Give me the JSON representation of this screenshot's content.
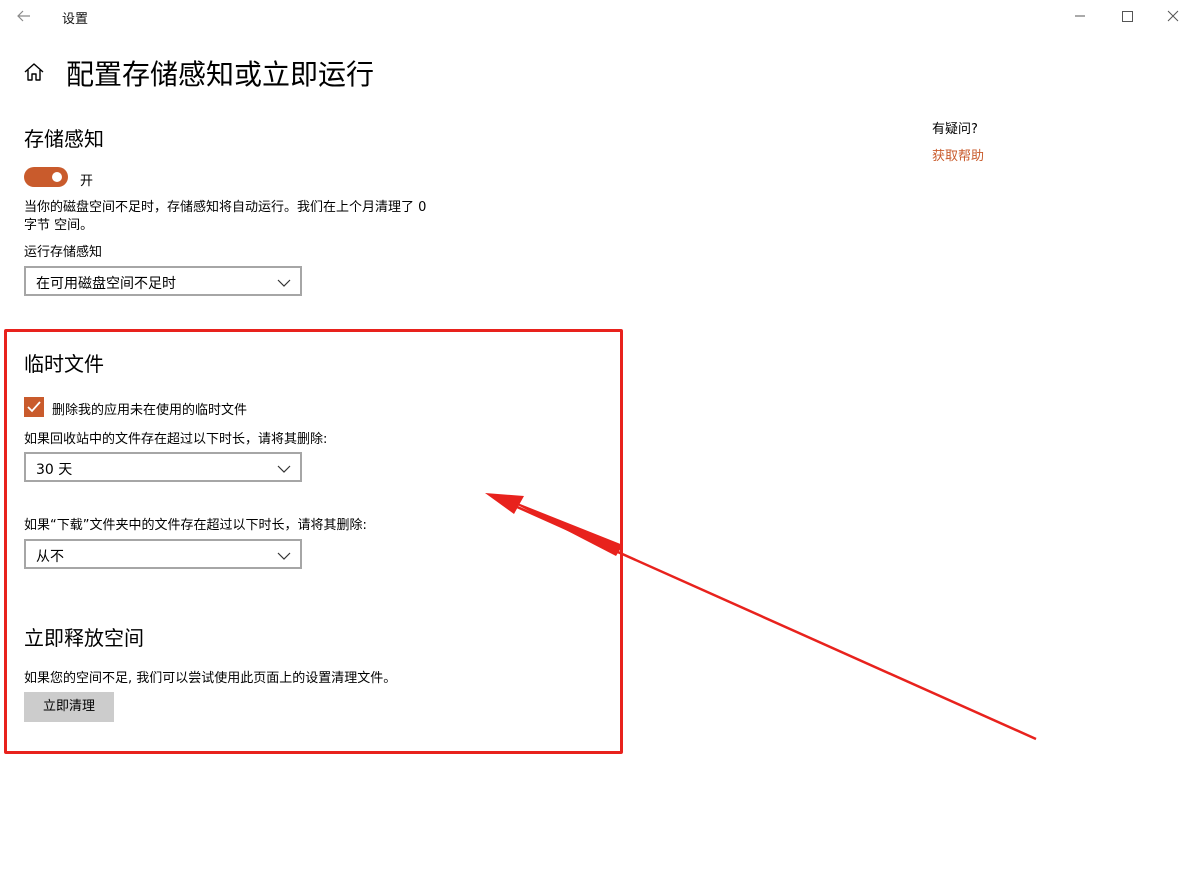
{
  "window": {
    "title": "设置",
    "back_icon": "arrow-left-icon",
    "controls": [
      "minimize-icon",
      "maximize-icon",
      "close-icon"
    ]
  },
  "page": {
    "home_icon": "home-icon",
    "title": "配置存储感知或立即运行"
  },
  "storage_sense": {
    "heading": "存储感知",
    "toggle_state": "开",
    "toggle_on": true,
    "description_line1": "当你的磁盘空间不足时，存储感知将自动运行。我们在上个月清理了 0",
    "description_line2": "字节 空间。",
    "run_label": "运行存储感知",
    "run_value": "在可用磁盘空间不足时"
  },
  "temp_files": {
    "heading": "临时文件",
    "delete_checkbox_label": "删除我的应用未在使用的临时文件",
    "delete_checked": true,
    "recycle_label": "如果回收站中的文件存在超过以下时长，请将其删除:",
    "recycle_value": "30 天",
    "downloads_label": "如果“下载”文件夹中的文件存在超过以下时长，请将其删除:",
    "downloads_value": "从不"
  },
  "free_space": {
    "heading": "立即释放空间",
    "description": "如果您的空间不足, 我们可以尝试使用此页面上的设置清理文件。",
    "button_label": "立即清理"
  },
  "help": {
    "question": "有疑问?",
    "link": "获取帮助"
  },
  "colors": {
    "accent": "#c95b2c",
    "annotation": "#e8221d",
    "button_bg": "#cccccc",
    "select_border": "#a6a6a6"
  }
}
